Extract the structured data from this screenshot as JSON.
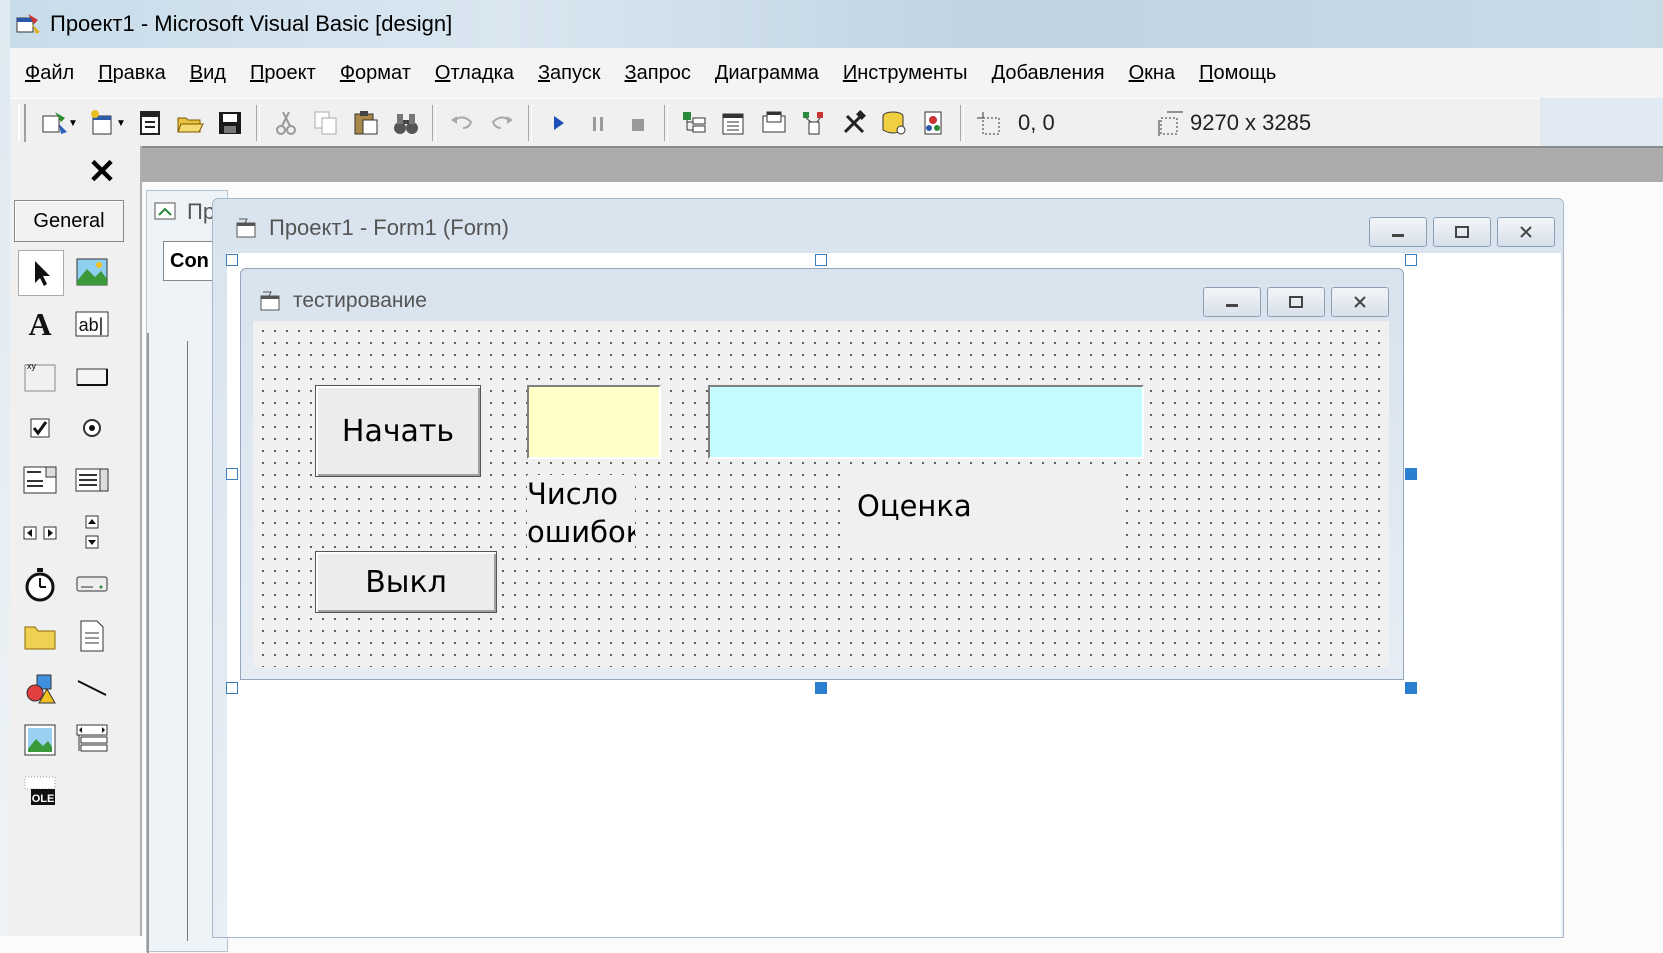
{
  "window": {
    "title": "Проект1 - Microsoft Visual Basic [design]"
  },
  "menu": [
    {
      "acc": "Ф",
      "rest": "айл"
    },
    {
      "acc": "П",
      "rest": "равка"
    },
    {
      "acc": "В",
      "rest": "ид"
    },
    {
      "acc": "П",
      "rest": "роект"
    },
    {
      "acc": "Ф",
      "pre": "",
      "rest": "ормат"
    },
    {
      "acc": "О",
      "rest": "тладка"
    },
    {
      "acc": "З",
      "rest": "апуск"
    },
    {
      "acc": "З",
      "rest": "апрос"
    },
    {
      "acc": "Д",
      "rest": "иаграмма"
    },
    {
      "acc": "И",
      "rest": "нструменты"
    },
    {
      "acc": "Д",
      "rest": "обавления"
    },
    {
      "acc": "О",
      "rest": "кна"
    },
    {
      "acc": "П",
      "rest": "омощь"
    }
  ],
  "toolbar": {
    "position": "0, 0",
    "size": "9270 x 3285"
  },
  "toolbox": {
    "tab": "General",
    "close": "✕"
  },
  "background_window": {
    "title": "Пр",
    "combo": "Con"
  },
  "designer": {
    "title": "Проект1 - Form1 (Form)"
  },
  "form": {
    "caption": "тестирование",
    "start_button": "Начать",
    "exit_button": "Выкл",
    "errors_label": "Число ошибок",
    "grade_label": "Оценка",
    "errors_box_color": "#ffffc8",
    "grade_box_color": "#c4fbfc"
  }
}
